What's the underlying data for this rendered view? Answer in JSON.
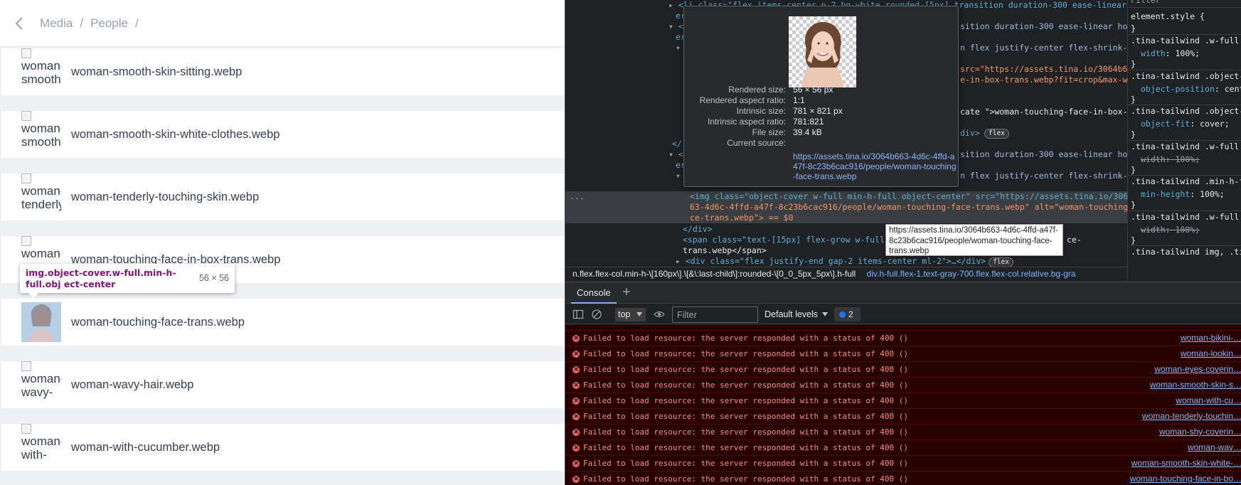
{
  "breadcrumb": [
    "Media",
    "People"
  ],
  "files": [
    {
      "name": "woman-smooth-skin-sitting.webp",
      "alt_lines": [
        "woman-",
        "smooth-"
      ],
      "has_image": false
    },
    {
      "name": "woman-smooth-skin-white-clothes.webp",
      "alt_lines": [
        "woman-",
        "smooth-"
      ],
      "has_image": false
    },
    {
      "name": "woman-tenderly-touching-skin.webp",
      "alt_lines": [
        "woman-",
        "tenderly-"
      ],
      "has_image": false
    },
    {
      "name": "woman-touching-face-in-box-trans.webp",
      "alt_lines": [
        "woman-",
        ""
      ],
      "has_image": false
    },
    {
      "name": "woman-touching-face-trans.webp",
      "alt_lines": [],
      "has_image": true
    },
    {
      "name": "woman-wavy-hair.webp",
      "alt_lines": [
        "woman-",
        "wavy-"
      ],
      "has_image": false
    },
    {
      "name": "woman-with-cucumber.webp",
      "alt_lines": [
        "woman-",
        "with-"
      ],
      "has_image": false
    }
  ],
  "element_tooltip": {
    "selector": "img.object-cover.w-full.min-h-full.obj ect-center",
    "size": "56 × 56"
  },
  "image_popup": {
    "rows": [
      {
        "key": "Rendered size:",
        "val": "56 × 56 px"
      },
      {
        "key": "Rendered aspect ratio:",
        "val": "1:1"
      },
      {
        "key": "Intrinsic size:",
        "val": "781 × 821 px"
      },
      {
        "key": "Intrinsic aspect ratio:",
        "val": "781:821"
      },
      {
        "key": "File size:",
        "val": "39.4 kB"
      },
      {
        "key": "Current source:",
        "val": ""
      }
    ],
    "source_url": "https://assets.tina.io/3064b663-4d6c-4ffd-a47f-8c23b6cac916/people/woman-touching-face-trans.webp"
  },
  "hover_url_tip": "https://assets.tina.io/3064b663-4d6c-4ffd-a47f-8c23b6cac916/people/woman-touching-face-trans.webp",
  "elements": {
    "line1": "<li class=\"flex items-center p-2 bg-white rounded-[5px] transition duration-300 ease-linear hov",
    "line2": "er",
    "line3": "sition duration-300 ease-linear hov",
    "line4": "n flex justify-center flex-shrink-0",
    "line5_src": "src=\"https://assets.tina.io/3064b6",
    "line6": "e-in-box-trans.webp?fit=crop&max-w=5",
    "line7": "cate \">woman-touching-face-in-box-",
    "line8": "div>",
    "line9": "sition duration-300 ease-linear hov",
    "line10": "n flex justify-center flex-shrink-0",
    "img_line1": "<img class=\"object-cover w-full min-h-full object-center\" src=\"https://assets.tina.io/3064b6",
    "img_line2": "63-4d6c-4ffd-a47f-8c23b6cac916/people/woman-touching-face-trans.webp\" alt=\"woman-touching-fa",
    "img_line3": "ce-trans.webp\"> == $0",
    "close_div": "</div>",
    "span_line1": "<span class=\"text-[15px] flex-grow w-full b",
    "span_line1_end": "ce-",
    "span_line2": "trans.webp</span>",
    "div_line": "<div class=\"flex justify-end gap-2 items-center ml-2\">…</div>",
    "flex_badge": "flex",
    "ellipsis": "..."
  },
  "dom_breadcrumb": {
    "part1": "n.flex.flex-col.min-h-\\[160px\\].\\[&\\:last-child\\]:rounded-\\[0_0_5px_5px\\].h-full",
    "part2": "div.h-full.flex-1.text-gray-700.flex.flex-col.relative.bg-gra",
    "more": "..."
  },
  "styles": {
    "filter_placeholder": "Filter",
    "element_style": "element.style {",
    "rules": [
      {
        "selector": ".tina-tailwind .w-full {",
        "prop": "width",
        "val": "100%;",
        "struck": false
      },
      {
        "selector": ".tina-tailwind .object-c",
        "prop": "object-position",
        "val": "cent",
        "struck": false
      },
      {
        "selector": ".tina-tailwind .object-c",
        "prop": "object-fit",
        "val": "cover;",
        "struck": false
      },
      {
        "selector": ".tina-tailwind .w-full {",
        "prop": "width",
        "val": "100%;",
        "struck": true
      },
      {
        "selector": ".tina-tailwind .min-h-f",
        "prop": "min-height",
        "val": "100%;",
        "struck": false
      },
      {
        "selector": ".tina-tailwind .w-full {",
        "prop": "width",
        "val": "100%;",
        "struck": true
      }
    ],
    "last": ".tina-tailwind img, .ti"
  },
  "console": {
    "tab": "Console",
    "context": "top",
    "filter_placeholder": "Filter",
    "levels": "Default levels",
    "issues_count": "2",
    "error_text": "Failed to load resource: the server responded with a status of 400 ()",
    "messages": [
      {
        "src": "woman-bikini-…"
      },
      {
        "src": "woman-lookin…"
      },
      {
        "src": "woman-eyes-coverin…"
      },
      {
        "src": "woman-smooth-skin-s…"
      },
      {
        "src": "woman-with-cu…"
      },
      {
        "src": "woman-tenderly-touchin…"
      },
      {
        "src": "woman-shy-coverin…"
      },
      {
        "src": "woman-wav…"
      },
      {
        "src": "woman-smooth-skin-white-…"
      },
      {
        "src": "woman-touching-face-in-bo…"
      }
    ]
  },
  "colors": {
    "error_bg": "#290000",
    "error_text": "#f28b82",
    "link": "#8ab4f8",
    "devtools_bg": "#202124",
    "highlight": "#6fa8dc"
  }
}
